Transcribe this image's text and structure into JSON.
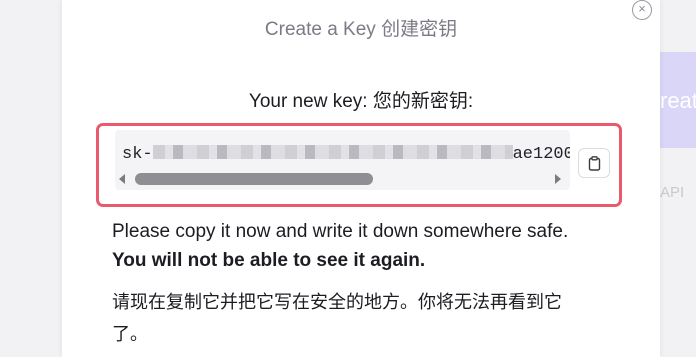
{
  "background": {
    "card_text": "reat",
    "api_text": "API"
  },
  "modal": {
    "title": "Create a Key  创建密钥",
    "key_label": "Your new key:  您的新密钥:",
    "key_prefix": "sk-",
    "key_suffix": "ae1200",
    "message_en": "Please copy it now and write it down somewhere safe.",
    "message_en_bold": "You will not be able to see it again.",
    "message_zh": "请现在复制它并把它写在安全的地方。你将无法再看到它了。"
  },
  "colors": {
    "highlight_border": "#e85a6c",
    "accent_bg": "#d9d6f7"
  },
  "icons": {
    "close": "close-icon",
    "copy": "clipboard-icon"
  }
}
